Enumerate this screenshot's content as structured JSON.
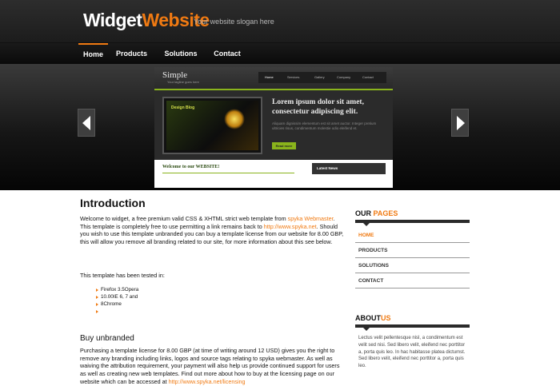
{
  "header": {
    "logo_part1": "Widget",
    "logo_part2": "Website",
    "slogan": "Your website slogan here"
  },
  "nav": {
    "items": [
      {
        "label": "Home",
        "active": true
      },
      {
        "label": "Products"
      },
      {
        "label": "Solutions"
      },
      {
        "label": "Contact"
      }
    ]
  },
  "preview": {
    "title": "Simple",
    "subtitle": "Your tagline goes here",
    "menu": [
      "Home",
      "Services",
      "Gallery",
      "Company",
      "Contact"
    ],
    "feature_title": "Design Blog",
    "headline": "Lorem ipsum dolor sit amet, consectetur adipiscing elit.",
    "body": "Aliquam dignissim elementum est sit amet auctor. Integer pretium ultricies risus, condimentum molestie odio eleifend et.",
    "button": "Read more",
    "welcome": "Welcome to our WEBSITE!",
    "news": "Latest News"
  },
  "content": {
    "intro_heading": "Introduction",
    "p1_a": "Welcome to widget, a free premium valid CSS & XHTML strict web template from ",
    "p1_link1": "spyka Webmaster",
    "p1_b": ". This template is completely free to use permitting a link remains back to ",
    "p1_link2": "http://www.spyka.net",
    "p1_c": ". Should you wish to use this template unbranded you can buy a template license from our website for 8.00 GBP, this will allow you remove all branding related to our site, for more information about this see below.",
    "p2": "This template has been tested in:",
    "browsers": [
      "Firefox 3.5Opera",
      "10.00IE 6, 7 and",
      "8Chrome",
      ""
    ],
    "buy_heading": "Buy unbranded",
    "p3_a": "Purchasing a template license for 8.00 GBP (at time of writing around 12 USD) gives you the right to remove any branding including links, logos and source tags relating to spyka webmaster. As well as waiving the attribution requirement, your payment will also help us provide continued support for users as well as creating new web templates. Find out more about how to buy at the licensing page on our website which can be accessed at ",
    "p3_link": "http://www.spyka.net/licensing"
  },
  "sidebar": {
    "pages_heading_a": "OUR ",
    "pages_heading_b": "PAGES",
    "pages": [
      {
        "label": "HOME",
        "active": true
      },
      {
        "label": "PRODUCTS"
      },
      {
        "label": "SOLUTIONS"
      },
      {
        "label": "CONTACT"
      }
    ],
    "about_heading_a": "ABOUT",
    "about_heading_b": "US",
    "about_text": "Lectus velit pellentesque nisl, a condimentum est velit sed nisi. Sed libero velit, eleifend nec porttitor a, porta quis leo. In hac habitasse platea dictumst. Sed libero velit, eleifend nec porttitor a, porta quis leo."
  },
  "colors": {
    "accent": "#f07a12",
    "header_bg": "#2d2d2d",
    "preview_green": "#8ab41c"
  }
}
